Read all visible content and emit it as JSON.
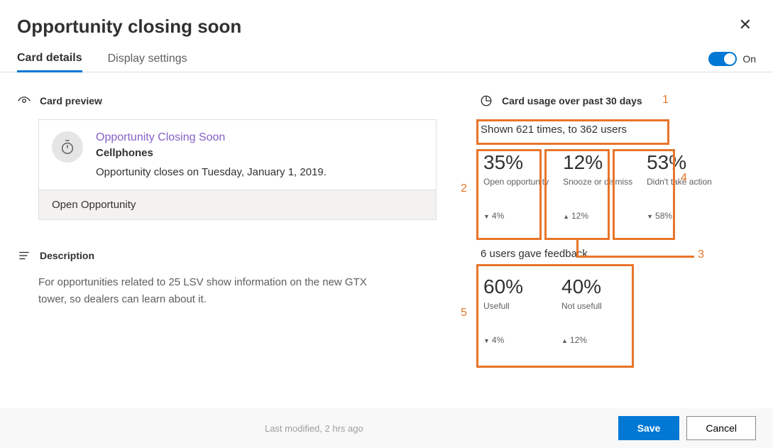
{
  "header": {
    "title": "Opportunity closing soon"
  },
  "tabs": [
    "Card details",
    "Display settings"
  ],
  "toggle": {
    "label": "On"
  },
  "preview": {
    "section_label": "Card preview",
    "card_title": "Opportunity Closing Soon",
    "card_subtitle": "Cellphones",
    "card_desc": "Opportunity closes on Tuesday, January 1, 2019.",
    "footer_action": "Open Opportunity"
  },
  "description": {
    "section_label": "Description",
    "text": "For opportunities related to 25 LSV show information on the new GTX tower, so dealers can learn about it."
  },
  "usage": {
    "section_label": "Card usage over past 30 days",
    "summary": "Shown 621 times, to 362 users",
    "stats": [
      {
        "pct": "35%",
        "label": "Open opportunity",
        "delta": "4%",
        "dir": "down"
      },
      {
        "pct": "12%",
        "label": "Snooze or dismiss",
        "delta": "12%",
        "dir": "up"
      },
      {
        "pct": "53%",
        "label": "Didn't take action",
        "delta": "58%",
        "dir": "down"
      }
    ],
    "feedback_summary": "6 users gave feedback",
    "feedback_stats": [
      {
        "pct": "60%",
        "label": "Usefull",
        "delta": "4%",
        "dir": "down"
      },
      {
        "pct": "40%",
        "label": "Not usefull",
        "delta": "12%",
        "dir": "up"
      }
    ]
  },
  "annotations": [
    "1",
    "2",
    "3",
    "4",
    "5"
  ],
  "footer": {
    "meta": "Last modified, 2 hrs ago",
    "save": "Save",
    "cancel": "Cancel"
  }
}
